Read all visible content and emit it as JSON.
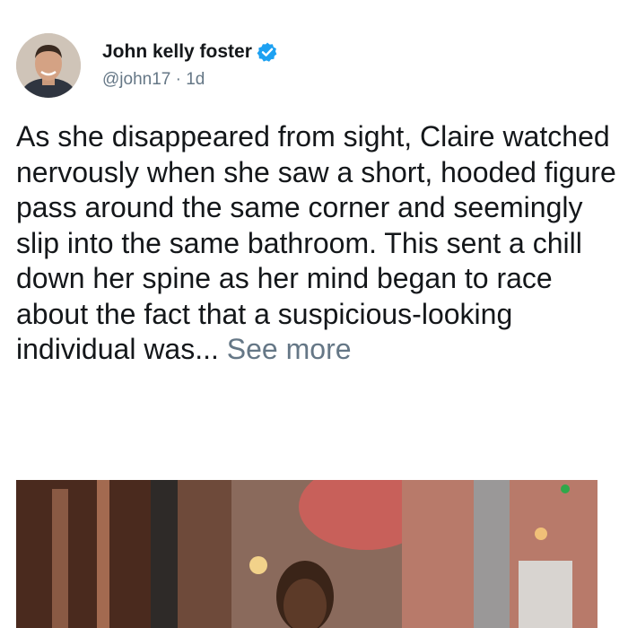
{
  "user": {
    "display_name": "John kelly foster",
    "handle": "@john17",
    "separator": "·",
    "time": "1d"
  },
  "tweet": {
    "text": "As she disappeared from sight, Claire watched nervously when she saw a short, hooded figure pass around the same corner and seemingly slip into the same bathroom. This sent a chill down her spine as her mind began to race about the fact that a suspicious-looking individual was...",
    "see_more_label": "See more"
  },
  "icons": {
    "verified": "verified-badge-icon"
  },
  "colors": {
    "verified_blue": "#1da1f2",
    "secondary_text": "#657786"
  }
}
